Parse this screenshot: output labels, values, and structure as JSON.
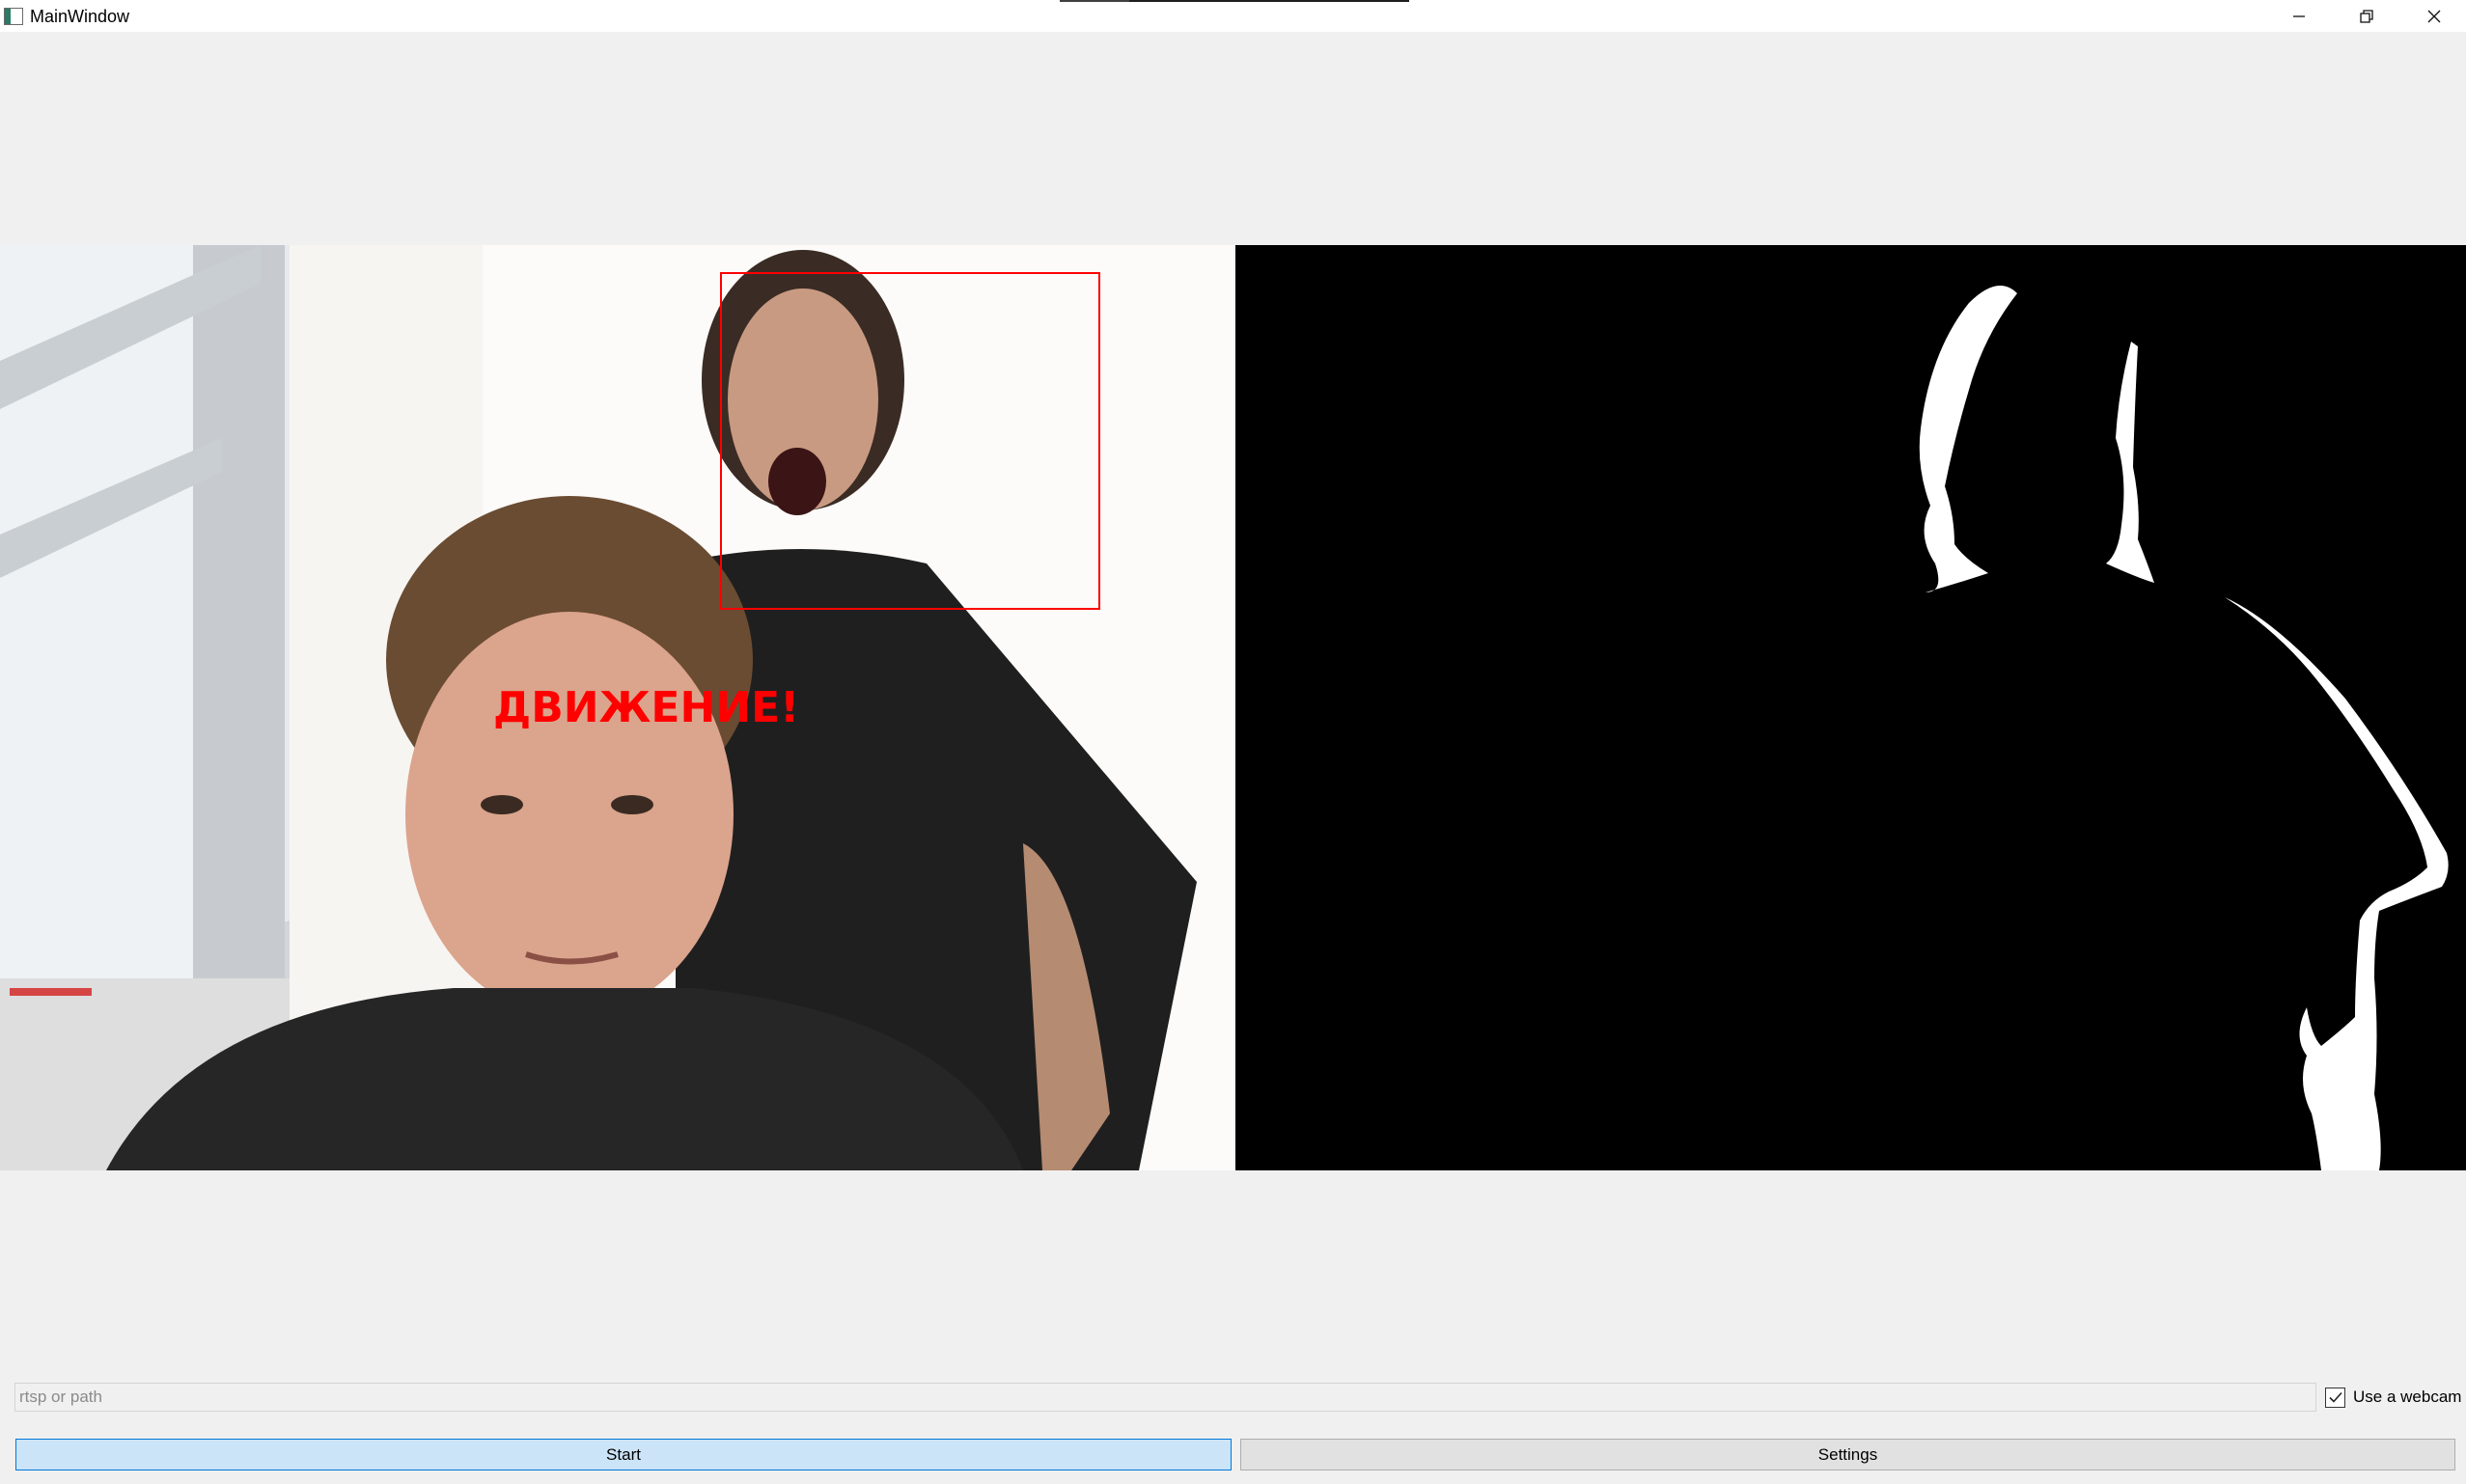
{
  "window": {
    "title": "MainWindow",
    "controls": {
      "minimize_icon": "minimize-icon",
      "restore_icon": "restore-icon",
      "close_icon": "close-icon"
    }
  },
  "video": {
    "left": {
      "overlay_text": "ДВИЖЕНИЕ!",
      "overlay_color": "#ff0000",
      "box_color": "#ff0000"
    },
    "right": {
      "background": "#000000",
      "mask_color": "#ffffff"
    }
  },
  "source": {
    "path_value": "",
    "path_placeholder": "rtsp or path",
    "webcam_label": "Use a webcam",
    "webcam_checked": true
  },
  "buttons": {
    "start_label": "Start",
    "settings_label": "Settings"
  },
  "colors": {
    "window_bg": "#f0f0f0",
    "start_button_bg": "#cce4f7",
    "start_button_border": "#0078d7",
    "settings_button_bg": "#e1e1e1"
  }
}
